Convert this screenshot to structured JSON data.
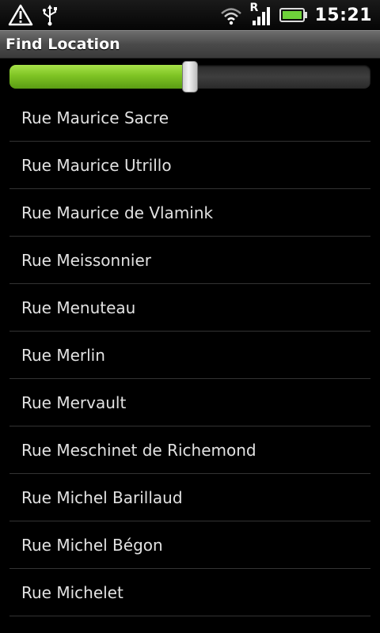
{
  "status_bar": {
    "time": "15:21",
    "signal_letter": "R",
    "icons": [
      "alert-icon",
      "usb-icon",
      "wifi-icon",
      "signal-icon",
      "battery-icon"
    ]
  },
  "header": {
    "title": "Find Location"
  },
  "slider": {
    "value_fraction": 0.5,
    "fill_color": "#8fd02e"
  },
  "list": {
    "items": [
      "Rue Maurice Sacre",
      "Rue Maurice Utrillo",
      "Rue Maurice de Vlamink",
      "Rue Meissonnier",
      "Rue Menuteau",
      "Rue Merlin",
      "Rue Mervault",
      "Rue Meschinet de Richemond",
      "Rue Michel Barillaud",
      "Rue Michel Bégon",
      "Rue Michelet"
    ]
  }
}
